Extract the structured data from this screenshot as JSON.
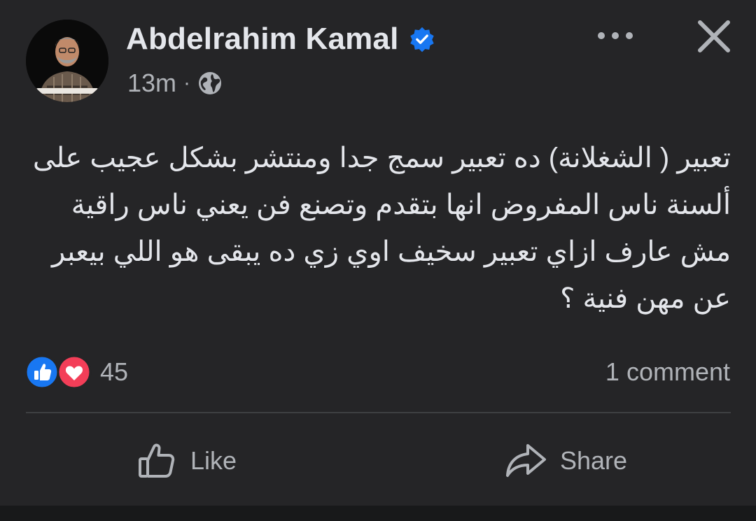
{
  "post": {
    "author": "Abdelrahim Kamal",
    "verified": true,
    "time": "13m",
    "separator": "·",
    "audience_icon": "globe-icon",
    "text": "تعبير ( الشغلانة) ده تعبير سمج جدا ومنتشر بشكل عجيب على ألسنة ناس المفروض انها بتقدم وتصنع فن يعني ناس راقية مش عارف ازاي تعبير سخيف اوي زي ده يبقى هو اللي بيعبر عن مهن فنية ؟"
  },
  "reactions": {
    "icons": [
      "like-reaction-icon",
      "love-reaction-icon"
    ],
    "count": "45",
    "comments_label": "1 comment"
  },
  "actions": {
    "like_label": "Like",
    "share_label": "Share"
  },
  "colors": {
    "background": "#252527",
    "text": "#e4e6eb",
    "secondary": "#b0b3b8",
    "verified_blue": "#1877f2",
    "like_blue": "#1877f2",
    "love_red": "#f33e58",
    "divider": "#3e4042"
  }
}
